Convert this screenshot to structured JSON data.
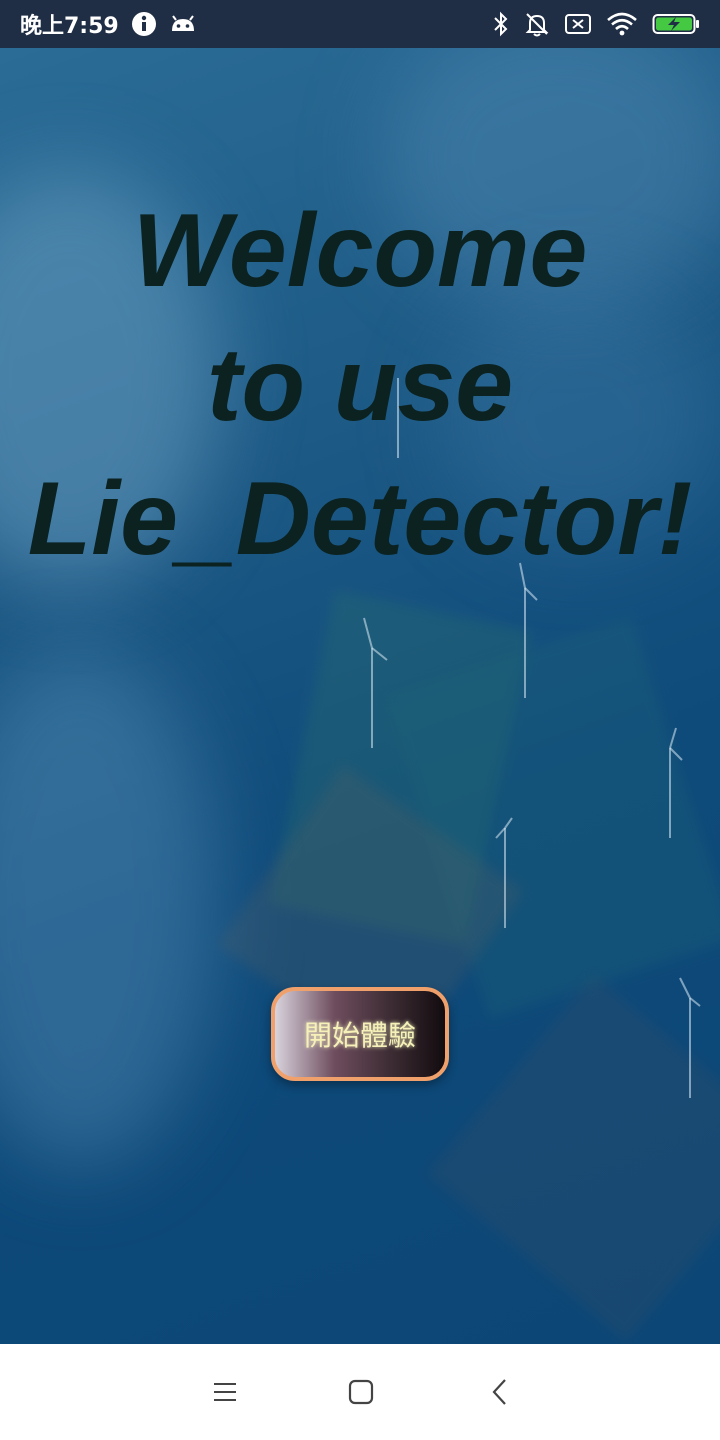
{
  "status_bar": {
    "time": "晚上7:59",
    "left_icons": [
      "info-icon",
      "android-icon"
    ],
    "right_icons": [
      "bluetooth-icon",
      "notifications-off-icon",
      "no-sim-icon",
      "wifi-icon",
      "battery-charging-icon"
    ],
    "background_color": "#1f2d45"
  },
  "welcome": {
    "lines": [
      "Welcome",
      "to use",
      "Lie_Detector!"
    ],
    "color": "#0b2220"
  },
  "start_button": {
    "label": "開始體驗",
    "border_color": "#f0a06a"
  },
  "nav_bar": {
    "icons": [
      "menu-icon",
      "home-icon",
      "back-icon"
    ]
  }
}
